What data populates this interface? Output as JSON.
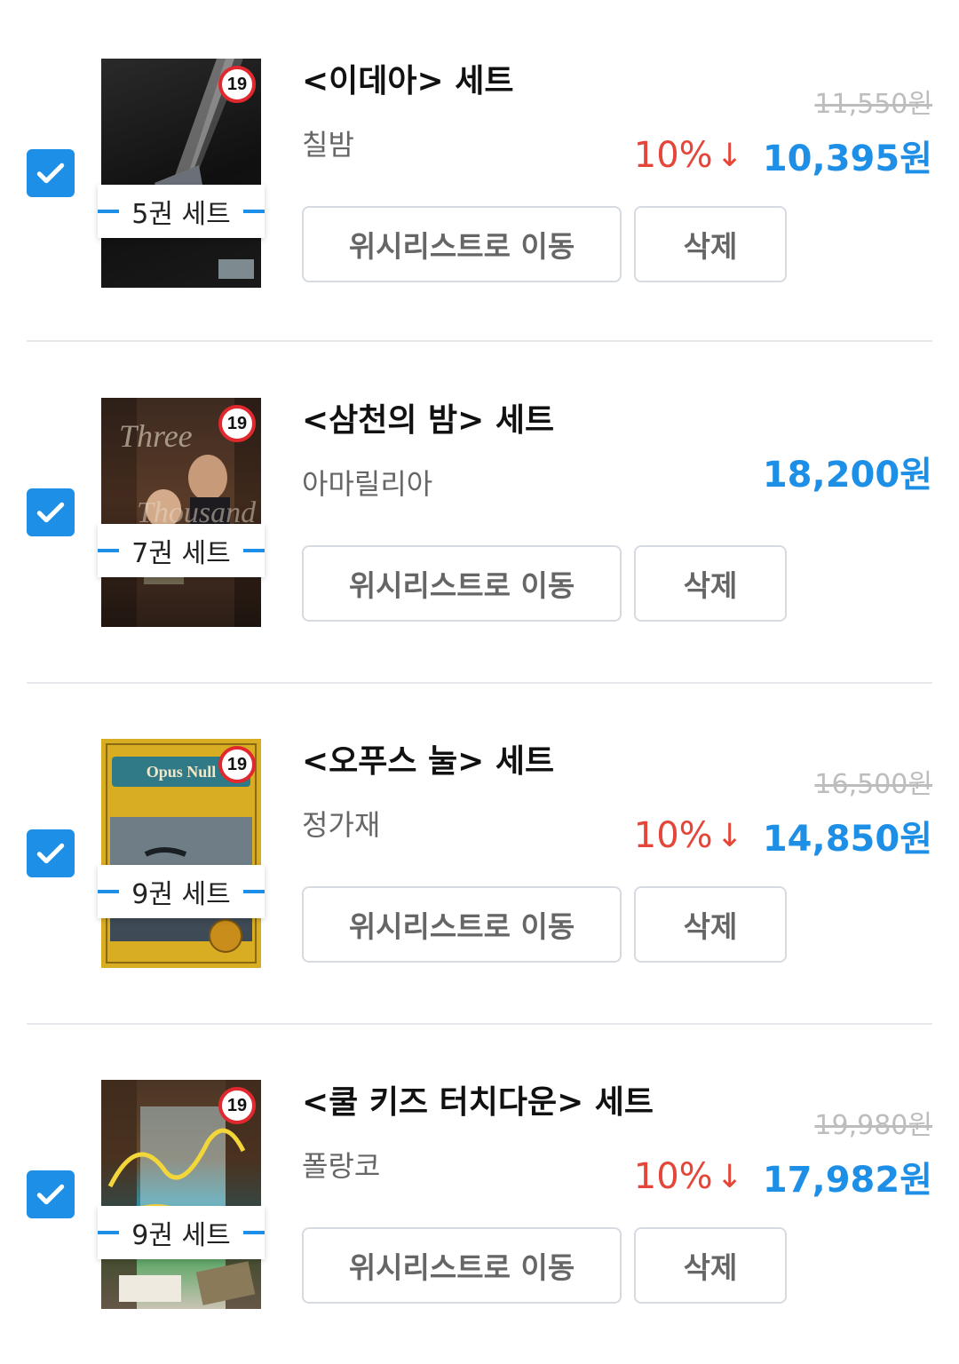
{
  "items": [
    {
      "title": "<이데아> 세트",
      "author": "칠밤",
      "original_price": "11,550원",
      "discount": "10%",
      "sale_price": "10,395원",
      "set_label": "5권 세트",
      "rating": "19",
      "checked": true
    },
    {
      "title": "<삼천의 밤> 세트",
      "author": "아마릴리아",
      "original_price": "",
      "discount": "",
      "sale_price": "18,200원",
      "set_label": "7권 세트",
      "rating": "19",
      "checked": true
    },
    {
      "title": "<오푸스 눌> 세트",
      "author": "정가재",
      "original_price": "16,500원",
      "discount": "10%",
      "sale_price": "14,850원",
      "set_label": "9권 세트",
      "rating": "19",
      "cover_text": "Opus Null",
      "checked": true
    },
    {
      "title": "<쿨 키즈 터치다운> 세트",
      "author": "폴랑코",
      "original_price": "19,980원",
      "discount": "10%",
      "sale_price": "17,982원",
      "set_label": "9권 세트",
      "rating": "19",
      "checked": true
    }
  ],
  "buttons": {
    "wishlist_label": "위시리스트로 이동",
    "delete_label": "삭제"
  },
  "colors": {
    "accent": "#1e8fe6",
    "discount": "#e5463a",
    "rating_ring": "#e0282e"
  }
}
